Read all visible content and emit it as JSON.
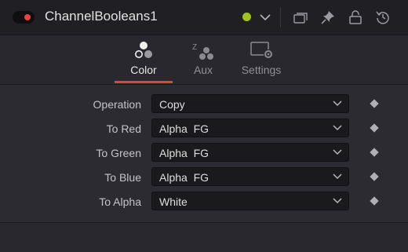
{
  "header": {
    "title": "ChannelBooleans1",
    "enabled_toggle_color": "#e8443a",
    "node_color": "#a3c21b",
    "icons": [
      "dropdown-chevron",
      "versions-icon",
      "pin-icon",
      "lock-icon",
      "reset-icon"
    ]
  },
  "tabs": [
    {
      "label": "Color",
      "icon": "color-channels-icon",
      "active": true
    },
    {
      "label": "Aux",
      "icon": "aux-channels-icon",
      "active": false
    },
    {
      "label": "Settings",
      "icon": "settings-icon",
      "active": false
    }
  ],
  "fields": [
    {
      "label": "Operation",
      "value": "Copy"
    },
    {
      "label": "To Red",
      "value": "Alpha  FG"
    },
    {
      "label": "To Green",
      "value": "Alpha  FG"
    },
    {
      "label": "To Blue",
      "value": "Alpha  FG"
    },
    {
      "label": "To Alpha",
      "value": "White"
    }
  ],
  "accent_color": "#d9483a"
}
